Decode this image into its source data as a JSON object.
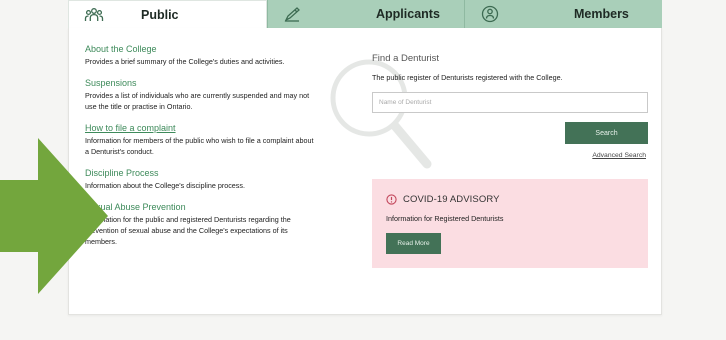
{
  "tabs": [
    {
      "label": "Public",
      "icon": "people-icon"
    },
    {
      "label": "Applicants",
      "icon": "pen-icon"
    },
    {
      "label": "Members",
      "icon": "member-badge-icon"
    }
  ],
  "public_links": [
    {
      "title": "About the College",
      "description": "Provides a brief summary of the College's duties and activities."
    },
    {
      "title": "Suspensions",
      "description": "Provides a list of individuals who are currently suspended and may not use the title or practise in Ontario."
    },
    {
      "title": "How to file a complaint",
      "description": "Information for members of the public who wish to file a complaint about a Denturist's conduct."
    },
    {
      "title": "Discipline Process",
      "description": "Information about the College's discipline process."
    },
    {
      "title": "Sexual Abuse Prevention",
      "description": "Information for the public and registered Denturists regarding the prevention of sexual abuse and the College's expectations of its members."
    }
  ],
  "find": {
    "title": "Find a Denturist",
    "description": "The public register of Denturists registered with the College.",
    "placeholder": "Name of Denturist",
    "search_label": "Search",
    "advanced_label": "Advanced Search"
  },
  "advisory": {
    "title": "COVID-19 ADVISORY",
    "description": "Information for Registered Denturists",
    "button_label": "Read More",
    "background": "#fbdde2"
  },
  "colors": {
    "accent_green": "#437257",
    "tab_green": "#a9cfb9",
    "link_green": "#3d8a5a",
    "arrow_green": "#73a63d"
  }
}
